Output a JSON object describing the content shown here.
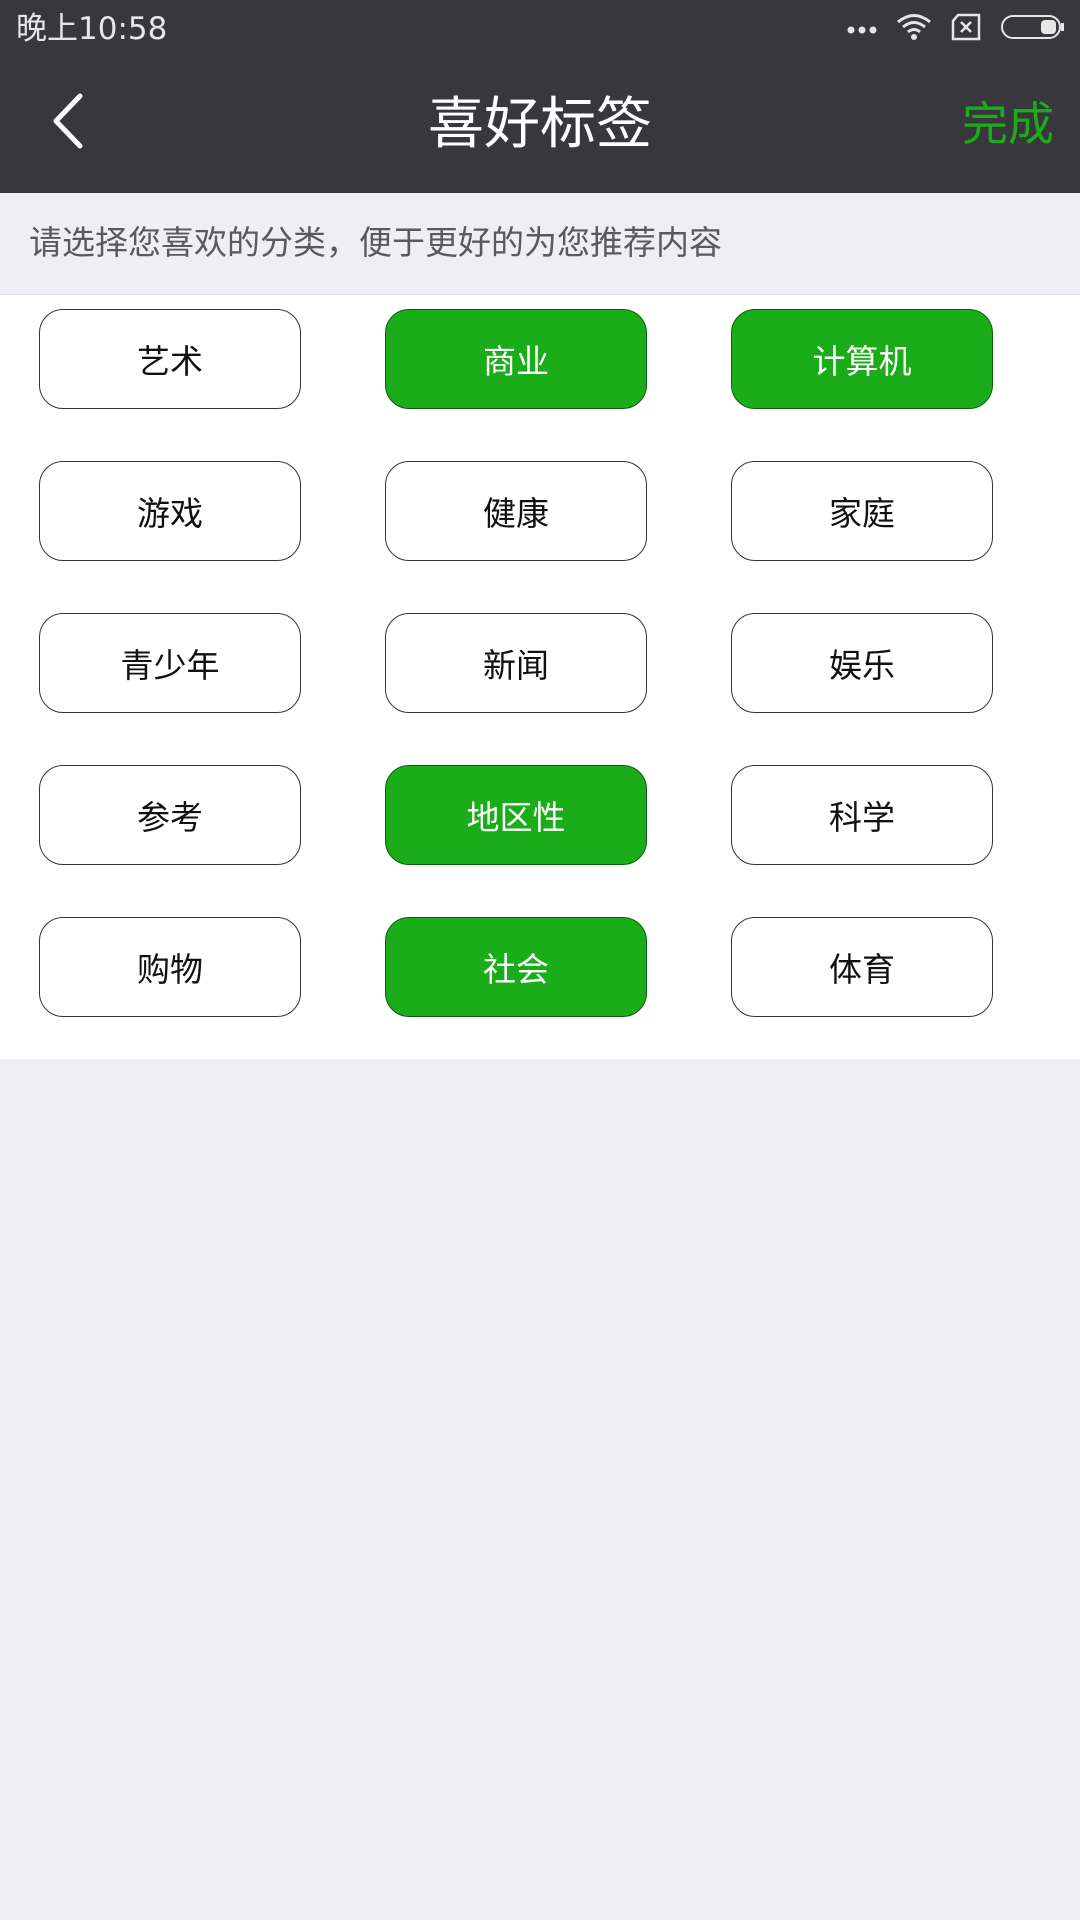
{
  "status_bar": {
    "time": "晚上10:58",
    "icons": [
      "more-dots-icon",
      "wifi-icon",
      "sim-off-icon",
      "battery-icon"
    ]
  },
  "nav": {
    "back_icon": "chevron-left-icon",
    "title": "喜好标签",
    "done_label": "完成"
  },
  "hint": {
    "text": "请选择您喜欢的分类，便于更好的为您推荐内容"
  },
  "tags": [
    {
      "label": "艺术",
      "selected": false
    },
    {
      "label": "商业",
      "selected": true
    },
    {
      "label": "计算机",
      "selected": true
    },
    {
      "label": "游戏",
      "selected": false
    },
    {
      "label": "健康",
      "selected": false
    },
    {
      "label": "家庭",
      "selected": false
    },
    {
      "label": "青少年",
      "selected": false
    },
    {
      "label": "新闻",
      "selected": false
    },
    {
      "label": "娱乐",
      "selected": false
    },
    {
      "label": "参考",
      "selected": false
    },
    {
      "label": "地区性",
      "selected": true
    },
    {
      "label": "科学",
      "selected": false
    },
    {
      "label": "购物",
      "selected": false
    },
    {
      "label": "社会",
      "selected": true
    },
    {
      "label": "体育",
      "selected": false
    }
  ],
  "colors": {
    "accent": "#1aad19",
    "header_bg": "#38383c",
    "page_bg": "#eeeef3"
  }
}
